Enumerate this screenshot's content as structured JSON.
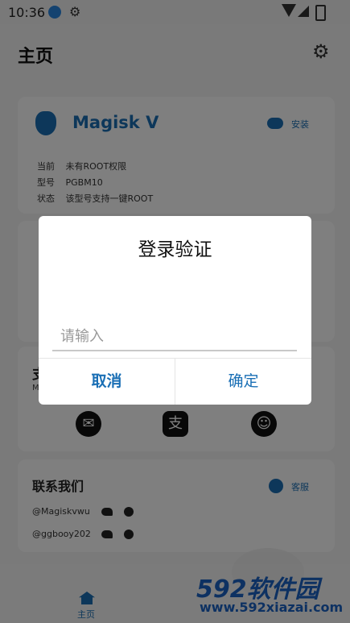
{
  "status_bar": {
    "time": "10:36"
  },
  "app_bar": {
    "title": "主页"
  },
  "magisk_card": {
    "app_name": "Magisk V",
    "install_label": "安装",
    "rows": [
      {
        "key": "当前",
        "value": "未有ROOT权限"
      },
      {
        "key": "型号",
        "value": "PGBM10"
      },
      {
        "key": "状态",
        "value": "该型号支持一键ROOT"
      }
    ]
  },
  "support_card": {
    "title_partial": "支",
    "subtitle_partial": "M"
  },
  "contact_card": {
    "title": "联系我们",
    "service_label": "客服",
    "handles": [
      "@Magiskvwu",
      "@ggbooy202"
    ]
  },
  "bottom_nav": {
    "home_label": "主页"
  },
  "watermark": {
    "brand": "592软件园",
    "url": "www.592xiazai.com"
  },
  "dialog": {
    "title": "登录验证",
    "input_placeholder": "请输入",
    "cancel_label": "取消",
    "confirm_label": "确定"
  },
  "colors": {
    "accent": "#1a6fb5",
    "scrim": "rgba(0,0,0,0.5)"
  }
}
